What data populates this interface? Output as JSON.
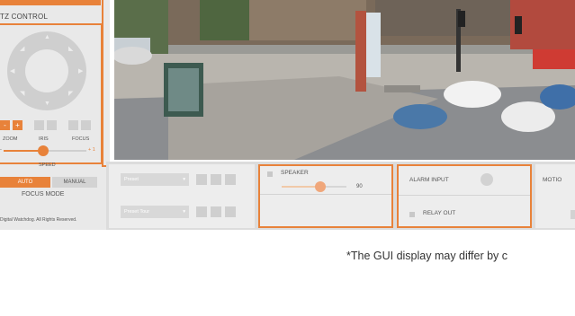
{
  "left_panel": {
    "ptz_title": "TZ CONTROL",
    "zoom_label": "ZOOM",
    "iris_label": "IRIS",
    "focus_label": "FOCUS",
    "minus": "-",
    "plus": "+",
    "speed_minus": "-",
    "speed_plus": "+ 1",
    "speed_label": "SPEED",
    "speed_value_fraction": 0.48,
    "auto_label": "AUTO",
    "manual_label": "MANUAL",
    "focus_mode_label": "FOCUS MODE",
    "copyright": "Digital Watchdog. All Rights Reserved."
  },
  "preset": {
    "preset_label": "Preset",
    "preset_tour_label": "Preset Tour"
  },
  "speaker": {
    "label": "SPEAKER",
    "value": "90",
    "value_fraction": 0.6
  },
  "alarm": {
    "alarm_input_label": "ALARM INPUT",
    "relay_out_label": "RELAY OUT"
  },
  "motion": {
    "label": "MOTIO"
  },
  "footnote": "*The GUI display may differ by c",
  "colors": {
    "accent": "#e8823a",
    "panel": "#e9e9e9"
  }
}
